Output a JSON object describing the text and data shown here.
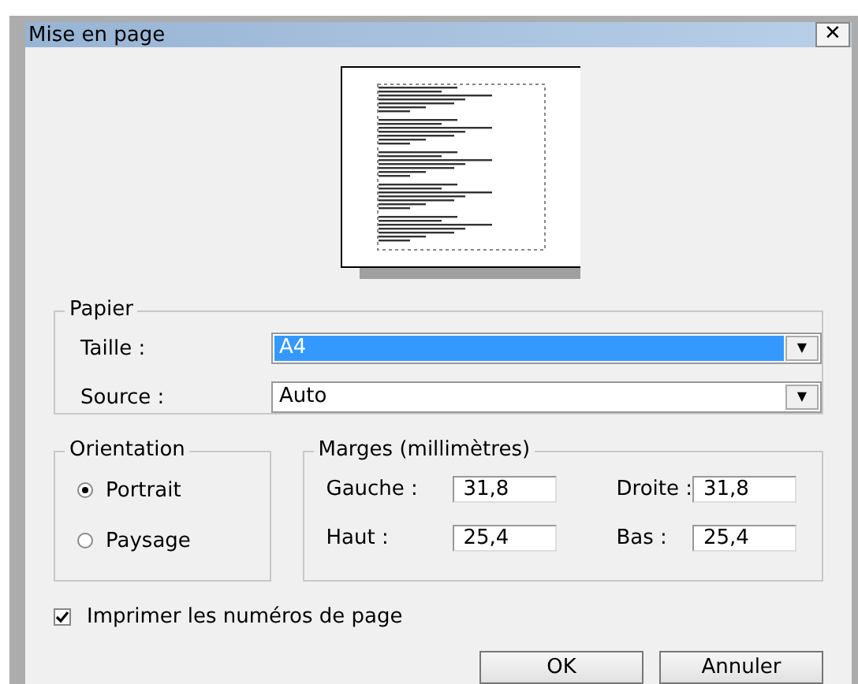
{
  "window": {
    "title": "Mise en page",
    "close": "✕"
  },
  "paper": {
    "title": "Papier",
    "fields": [
      {
        "label": "Taille :",
        "value": "A4",
        "highlighted": true,
        "arrow": "▼"
      },
      {
        "label": "Source :",
        "value": "Auto",
        "highlighted": false,
        "arrow": "▼"
      }
    ]
  },
  "orientation": {
    "title": "Orientation",
    "options": [
      {
        "label": "Portrait",
        "selected": true
      },
      {
        "label": "Paysage",
        "selected": false
      }
    ]
  },
  "margins": {
    "title": "Marges (millimètres)",
    "fields": [
      {
        "label": "Gauche :",
        "value": "31,8"
      },
      {
        "label": "Droite :",
        "value": "31,8"
      },
      {
        "label": "Haut :",
        "value": "25,4"
      },
      {
        "label": "Bas :",
        "value": "25,4"
      }
    ]
  },
  "page_numbers": {
    "label": "Imprimer les numéros de page",
    "checked": true
  },
  "buttons": [
    "OK",
    "Annuler"
  ]
}
